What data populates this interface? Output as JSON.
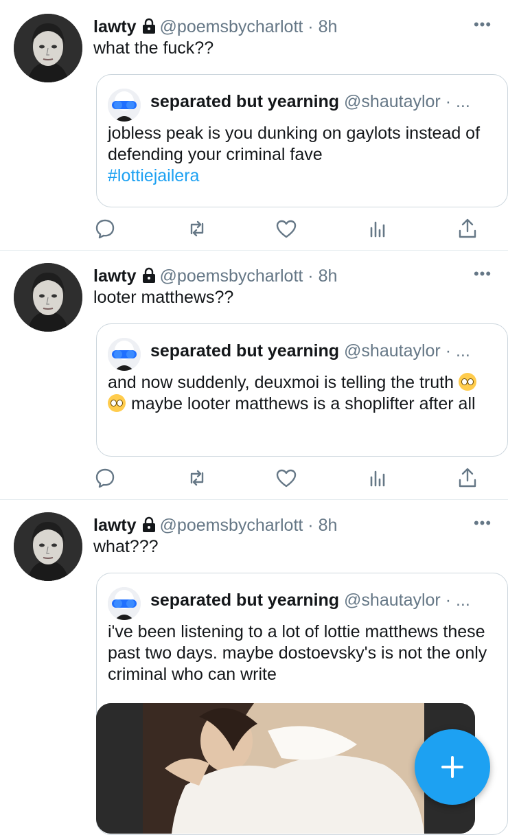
{
  "accent_color": "#1da1f2",
  "more_label": "•••",
  "tweets": [
    {
      "name": "lawty",
      "handle": "@poemsbycharlott",
      "time": "· 8h",
      "text": "what the fuck??",
      "quote": {
        "name": "separated but yearning",
        "handle": "@shautaylor · ...",
        "text": "jobless peak is you dunking on gaylots instead of defending your criminal fave",
        "hashtag": "#lottiejailera"
      }
    },
    {
      "name": "lawty",
      "handle": "@poemsbycharlott",
      "time": "· 8h",
      "text": "looter matthews??",
      "quote": {
        "name": "separated but yearning",
        "handle": "@shautaylor · ...",
        "text_before": "and now suddenly, deuxmoi is telling the truth",
        "emoji": "eye-roll-emoji",
        "text_after": "maybe looter matthews is a shoplifter after all"
      }
    },
    {
      "name": "lawty",
      "handle": "@poemsbycharlott",
      "time": "· 8h",
      "text": "what???",
      "quote": {
        "name": "separated but yearning",
        "handle": "@shautaylor · ...",
        "text": "i've been listening to a lot of lottie matthews these past two days. maybe dostoevsky's is not the only criminal who can write"
      }
    }
  ],
  "icons": [
    "reply-icon",
    "retweet-icon",
    "like-icon",
    "analytics-icon",
    "share-icon",
    "lock-icon",
    "compose-plus-icon"
  ]
}
